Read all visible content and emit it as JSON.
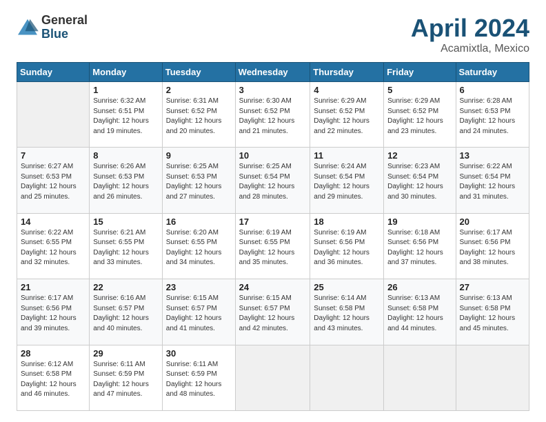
{
  "logo": {
    "general": "General",
    "blue": "Blue"
  },
  "title": {
    "month_year": "April 2024",
    "location": "Acamixtla, Mexico"
  },
  "days_of_week": [
    "Sunday",
    "Monday",
    "Tuesday",
    "Wednesday",
    "Thursday",
    "Friday",
    "Saturday"
  ],
  "weeks": [
    [
      {
        "day": "",
        "info": ""
      },
      {
        "day": "1",
        "info": "Sunrise: 6:32 AM\nSunset: 6:51 PM\nDaylight: 12 hours\nand 19 minutes."
      },
      {
        "day": "2",
        "info": "Sunrise: 6:31 AM\nSunset: 6:52 PM\nDaylight: 12 hours\nand 20 minutes."
      },
      {
        "day": "3",
        "info": "Sunrise: 6:30 AM\nSunset: 6:52 PM\nDaylight: 12 hours\nand 21 minutes."
      },
      {
        "day": "4",
        "info": "Sunrise: 6:29 AM\nSunset: 6:52 PM\nDaylight: 12 hours\nand 22 minutes."
      },
      {
        "day": "5",
        "info": "Sunrise: 6:29 AM\nSunset: 6:52 PM\nDaylight: 12 hours\nand 23 minutes."
      },
      {
        "day": "6",
        "info": "Sunrise: 6:28 AM\nSunset: 6:53 PM\nDaylight: 12 hours\nand 24 minutes."
      }
    ],
    [
      {
        "day": "7",
        "info": "Sunrise: 6:27 AM\nSunset: 6:53 PM\nDaylight: 12 hours\nand 25 minutes."
      },
      {
        "day": "8",
        "info": "Sunrise: 6:26 AM\nSunset: 6:53 PM\nDaylight: 12 hours\nand 26 minutes."
      },
      {
        "day": "9",
        "info": "Sunrise: 6:25 AM\nSunset: 6:53 PM\nDaylight: 12 hours\nand 27 minutes."
      },
      {
        "day": "10",
        "info": "Sunrise: 6:25 AM\nSunset: 6:54 PM\nDaylight: 12 hours\nand 28 minutes."
      },
      {
        "day": "11",
        "info": "Sunrise: 6:24 AM\nSunset: 6:54 PM\nDaylight: 12 hours\nand 29 minutes."
      },
      {
        "day": "12",
        "info": "Sunrise: 6:23 AM\nSunset: 6:54 PM\nDaylight: 12 hours\nand 30 minutes."
      },
      {
        "day": "13",
        "info": "Sunrise: 6:22 AM\nSunset: 6:54 PM\nDaylight: 12 hours\nand 31 minutes."
      }
    ],
    [
      {
        "day": "14",
        "info": "Sunrise: 6:22 AM\nSunset: 6:55 PM\nDaylight: 12 hours\nand 32 minutes."
      },
      {
        "day": "15",
        "info": "Sunrise: 6:21 AM\nSunset: 6:55 PM\nDaylight: 12 hours\nand 33 minutes."
      },
      {
        "day": "16",
        "info": "Sunrise: 6:20 AM\nSunset: 6:55 PM\nDaylight: 12 hours\nand 34 minutes."
      },
      {
        "day": "17",
        "info": "Sunrise: 6:19 AM\nSunset: 6:55 PM\nDaylight: 12 hours\nand 35 minutes."
      },
      {
        "day": "18",
        "info": "Sunrise: 6:19 AM\nSunset: 6:56 PM\nDaylight: 12 hours\nand 36 minutes."
      },
      {
        "day": "19",
        "info": "Sunrise: 6:18 AM\nSunset: 6:56 PM\nDaylight: 12 hours\nand 37 minutes."
      },
      {
        "day": "20",
        "info": "Sunrise: 6:17 AM\nSunset: 6:56 PM\nDaylight: 12 hours\nand 38 minutes."
      }
    ],
    [
      {
        "day": "21",
        "info": "Sunrise: 6:17 AM\nSunset: 6:56 PM\nDaylight: 12 hours\nand 39 minutes."
      },
      {
        "day": "22",
        "info": "Sunrise: 6:16 AM\nSunset: 6:57 PM\nDaylight: 12 hours\nand 40 minutes."
      },
      {
        "day": "23",
        "info": "Sunrise: 6:15 AM\nSunset: 6:57 PM\nDaylight: 12 hours\nand 41 minutes."
      },
      {
        "day": "24",
        "info": "Sunrise: 6:15 AM\nSunset: 6:57 PM\nDaylight: 12 hours\nand 42 minutes."
      },
      {
        "day": "25",
        "info": "Sunrise: 6:14 AM\nSunset: 6:58 PM\nDaylight: 12 hours\nand 43 minutes."
      },
      {
        "day": "26",
        "info": "Sunrise: 6:13 AM\nSunset: 6:58 PM\nDaylight: 12 hours\nand 44 minutes."
      },
      {
        "day": "27",
        "info": "Sunrise: 6:13 AM\nSunset: 6:58 PM\nDaylight: 12 hours\nand 45 minutes."
      }
    ],
    [
      {
        "day": "28",
        "info": "Sunrise: 6:12 AM\nSunset: 6:58 PM\nDaylight: 12 hours\nand 46 minutes."
      },
      {
        "day": "29",
        "info": "Sunrise: 6:11 AM\nSunset: 6:59 PM\nDaylight: 12 hours\nand 47 minutes."
      },
      {
        "day": "30",
        "info": "Sunrise: 6:11 AM\nSunset: 6:59 PM\nDaylight: 12 hours\nand 48 minutes."
      },
      {
        "day": "",
        "info": ""
      },
      {
        "day": "",
        "info": ""
      },
      {
        "day": "",
        "info": ""
      },
      {
        "day": "",
        "info": ""
      }
    ]
  ]
}
